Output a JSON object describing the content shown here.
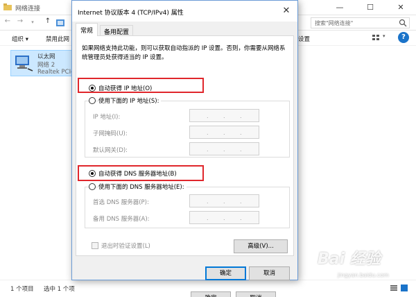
{
  "explorer": {
    "title": "网络连接",
    "window_controls": {
      "minimize": "—",
      "maximize": "☐",
      "close": "✕"
    },
    "search_placeholder": "搜索\"网络连接\"",
    "commands": {
      "organize": "组织 ▾",
      "disable": "禁用此网",
      "settings": "设置"
    },
    "adapter": {
      "name": "以太网",
      "network": "网络 2",
      "device": "Realtek PCIe"
    },
    "status": {
      "count": "1 个项目",
      "selected": "选中 1 个项"
    }
  },
  "dialog": {
    "title": "Internet 协议版本 4 (TCP/IPv4) 属性",
    "close": "✕",
    "tabs": [
      "常规",
      "备用配置"
    ],
    "intro": "如果网络支持此功能，则可以获取自动指派的 IP 设置。否则，你需要从网络系统管理员处获得适当的 IP 设置。",
    "ip_auto": "自动获得 IP 地址(O)",
    "ip_manual": "使用下面的 IP 地址(S):",
    "ip_fields": [
      "IP 地址(I):",
      "子网掩码(U):",
      "默认网关(D):"
    ],
    "dns_auto": "自动获得 DNS 服务器地址(B)",
    "dns_manual": "使用下面的 DNS 服务器地址(E):",
    "dns_fields": [
      "首选 DNS 服务器(P):",
      "备用 DNS 服务器(A):"
    ],
    "validate": "退出时验证设置(L)",
    "advanced": "高级(V)...",
    "ok": "确定",
    "cancel": "取消"
  },
  "behind_buttons": {
    "ok": "确定",
    "cancel": "取消"
  },
  "watermark": {
    "logo": "Bai 经验",
    "url": "jingyan.baidu.com"
  },
  "colors": {
    "highlight": "#e0262b",
    "selection": "#cce8ff",
    "accent": "#0078d7"
  }
}
